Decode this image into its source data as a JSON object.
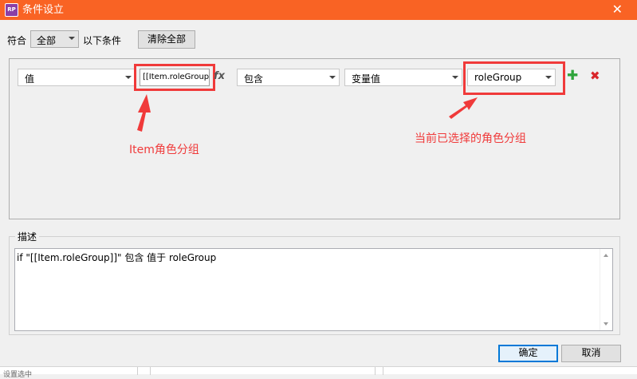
{
  "window": {
    "app_icon": "RP",
    "title": "条件设立",
    "close_glyph": "✕"
  },
  "match": {
    "label": "符合",
    "value": "全部",
    "suffix": "以下条件"
  },
  "clear_all_label": "清除全部",
  "condition": {
    "left_type": "值",
    "value_text": "[[Item.roleGroup]]",
    "fx_label": "fx",
    "operator": "包含",
    "right_type": "变量值",
    "variable": "roleGroup",
    "add_glyph": "✚",
    "remove_glyph": "✖"
  },
  "annotations": {
    "left": "Item角色分组",
    "right": "当前已选择的角色分组",
    "color": "#f03a3a"
  },
  "description": {
    "legend": "描述",
    "text": "if \"[[Item.roleGroup]]\" 包含 值于 roleGroup"
  },
  "buttons": {
    "ok": "确定",
    "cancel": "取消"
  },
  "background_clip_text": "设置选中",
  "colors": {
    "titlebar": "#f96324",
    "ok_border": "#0078d7"
  }
}
